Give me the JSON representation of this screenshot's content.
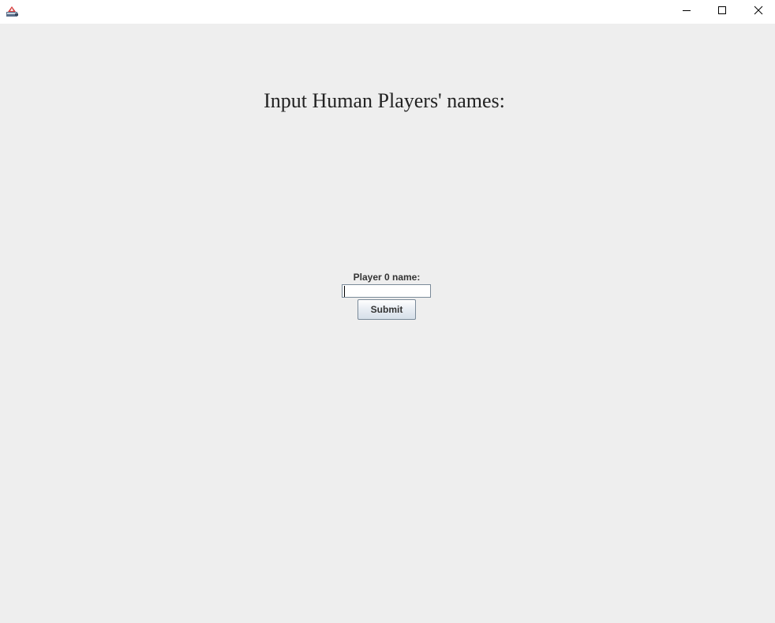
{
  "window": {
    "app_icon": "java-cup-icon",
    "controls": {
      "minimize_icon": "minimize-icon",
      "maximize_icon": "maximize-icon",
      "close_icon": "close-icon"
    }
  },
  "main": {
    "heading": "Input Human Players' names:",
    "field_label": "Player 0 name:",
    "name_input": {
      "value": "",
      "placeholder": ""
    },
    "submit_label": "Submit"
  },
  "colors": {
    "background": "#eeeeee",
    "titlebar": "#ffffff",
    "input_border": "#7a8a99"
  }
}
